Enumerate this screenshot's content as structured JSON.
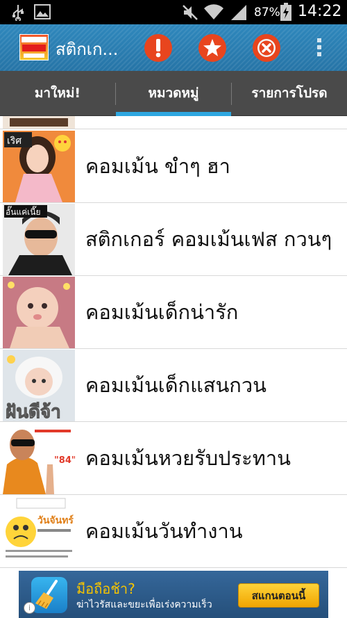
{
  "status_bar": {
    "battery_percent": "87%",
    "time": "14:22",
    "icons": [
      "usb-icon",
      "image-icon",
      "mute-icon",
      "wifi-icon",
      "signal-icon",
      "battery-charging-icon"
    ]
  },
  "action_bar": {
    "title": "สติกเก...",
    "buttons": [
      "alert-icon",
      "star-icon",
      "close-icon",
      "overflow-menu-icon"
    ]
  },
  "tabs": [
    {
      "label": "มาใหม่!",
      "selected": false
    },
    {
      "label": "หมวดหมู่",
      "selected": true
    },
    {
      "label": "รายการโปรด",
      "selected": false
    }
  ],
  "list": {
    "items": [
      {
        "label": "คอมเม้น ขำๆ ฮา",
        "thumb_caption": "เริศ"
      },
      {
        "label": "สติกเกอร์ คอมเม้นเฟส กวนๆ",
        "thumb_caption": "อั๊นแค่เนี๊ย"
      },
      {
        "label": "คอมเม้นเด็กน่ารัก",
        "thumb_caption": ""
      },
      {
        "label": "คอมเม้นเด็กแสนกวน",
        "thumb_caption": "ฝันดีจ้า"
      },
      {
        "label": "คอมเม้นหวยรับประทาน",
        "thumb_caption": "\"84\""
      },
      {
        "label": "คอมเม้นวันทำงาน",
        "thumb_caption": "วันจันทร์"
      }
    ]
  },
  "ad": {
    "headline": "มือถือช้า?",
    "subtext": "ฆ่าไวรัสและขยะเพื่อเร่งความเร็ว",
    "button_label": "สแกนตอนนี้",
    "info_label": "i"
  },
  "colors": {
    "action_bar": "#2b7fb3",
    "tab_bar": "#4a4a4a",
    "tab_indicator": "#2ea7e0",
    "action_button": "#e8451e"
  }
}
